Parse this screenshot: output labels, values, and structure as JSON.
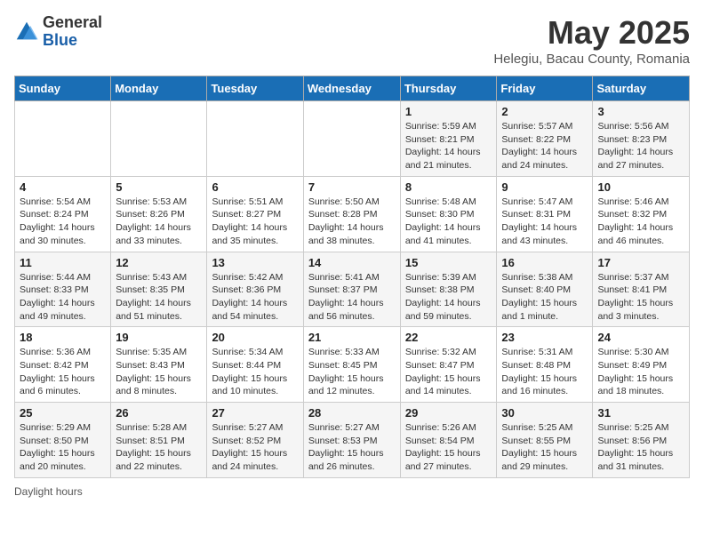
{
  "header": {
    "logo_general": "General",
    "logo_blue": "Blue",
    "title": "May 2025",
    "subtitle": "Helegiu, Bacau County, Romania"
  },
  "days_of_week": [
    "Sunday",
    "Monday",
    "Tuesday",
    "Wednesday",
    "Thursday",
    "Friday",
    "Saturday"
  ],
  "footer": "Daylight hours",
  "weeks": [
    [
      {
        "day": "",
        "info": ""
      },
      {
        "day": "",
        "info": ""
      },
      {
        "day": "",
        "info": ""
      },
      {
        "day": "",
        "info": ""
      },
      {
        "day": "1",
        "info": "Sunrise: 5:59 AM\nSunset: 8:21 PM\nDaylight: 14 hours and 21 minutes."
      },
      {
        "day": "2",
        "info": "Sunrise: 5:57 AM\nSunset: 8:22 PM\nDaylight: 14 hours and 24 minutes."
      },
      {
        "day": "3",
        "info": "Sunrise: 5:56 AM\nSunset: 8:23 PM\nDaylight: 14 hours and 27 minutes."
      }
    ],
    [
      {
        "day": "4",
        "info": "Sunrise: 5:54 AM\nSunset: 8:24 PM\nDaylight: 14 hours and 30 minutes."
      },
      {
        "day": "5",
        "info": "Sunrise: 5:53 AM\nSunset: 8:26 PM\nDaylight: 14 hours and 33 minutes."
      },
      {
        "day": "6",
        "info": "Sunrise: 5:51 AM\nSunset: 8:27 PM\nDaylight: 14 hours and 35 minutes."
      },
      {
        "day": "7",
        "info": "Sunrise: 5:50 AM\nSunset: 8:28 PM\nDaylight: 14 hours and 38 minutes."
      },
      {
        "day": "8",
        "info": "Sunrise: 5:48 AM\nSunset: 8:30 PM\nDaylight: 14 hours and 41 minutes."
      },
      {
        "day": "9",
        "info": "Sunrise: 5:47 AM\nSunset: 8:31 PM\nDaylight: 14 hours and 43 minutes."
      },
      {
        "day": "10",
        "info": "Sunrise: 5:46 AM\nSunset: 8:32 PM\nDaylight: 14 hours and 46 minutes."
      }
    ],
    [
      {
        "day": "11",
        "info": "Sunrise: 5:44 AM\nSunset: 8:33 PM\nDaylight: 14 hours and 49 minutes."
      },
      {
        "day": "12",
        "info": "Sunrise: 5:43 AM\nSunset: 8:35 PM\nDaylight: 14 hours and 51 minutes."
      },
      {
        "day": "13",
        "info": "Sunrise: 5:42 AM\nSunset: 8:36 PM\nDaylight: 14 hours and 54 minutes."
      },
      {
        "day": "14",
        "info": "Sunrise: 5:41 AM\nSunset: 8:37 PM\nDaylight: 14 hours and 56 minutes."
      },
      {
        "day": "15",
        "info": "Sunrise: 5:39 AM\nSunset: 8:38 PM\nDaylight: 14 hours and 59 minutes."
      },
      {
        "day": "16",
        "info": "Sunrise: 5:38 AM\nSunset: 8:40 PM\nDaylight: 15 hours and 1 minute."
      },
      {
        "day": "17",
        "info": "Sunrise: 5:37 AM\nSunset: 8:41 PM\nDaylight: 15 hours and 3 minutes."
      }
    ],
    [
      {
        "day": "18",
        "info": "Sunrise: 5:36 AM\nSunset: 8:42 PM\nDaylight: 15 hours and 6 minutes."
      },
      {
        "day": "19",
        "info": "Sunrise: 5:35 AM\nSunset: 8:43 PM\nDaylight: 15 hours and 8 minutes."
      },
      {
        "day": "20",
        "info": "Sunrise: 5:34 AM\nSunset: 8:44 PM\nDaylight: 15 hours and 10 minutes."
      },
      {
        "day": "21",
        "info": "Sunrise: 5:33 AM\nSunset: 8:45 PM\nDaylight: 15 hours and 12 minutes."
      },
      {
        "day": "22",
        "info": "Sunrise: 5:32 AM\nSunset: 8:47 PM\nDaylight: 15 hours and 14 minutes."
      },
      {
        "day": "23",
        "info": "Sunrise: 5:31 AM\nSunset: 8:48 PM\nDaylight: 15 hours and 16 minutes."
      },
      {
        "day": "24",
        "info": "Sunrise: 5:30 AM\nSunset: 8:49 PM\nDaylight: 15 hours and 18 minutes."
      }
    ],
    [
      {
        "day": "25",
        "info": "Sunrise: 5:29 AM\nSunset: 8:50 PM\nDaylight: 15 hours and 20 minutes."
      },
      {
        "day": "26",
        "info": "Sunrise: 5:28 AM\nSunset: 8:51 PM\nDaylight: 15 hours and 22 minutes."
      },
      {
        "day": "27",
        "info": "Sunrise: 5:27 AM\nSunset: 8:52 PM\nDaylight: 15 hours and 24 minutes."
      },
      {
        "day": "28",
        "info": "Sunrise: 5:27 AM\nSunset: 8:53 PM\nDaylight: 15 hours and 26 minutes."
      },
      {
        "day": "29",
        "info": "Sunrise: 5:26 AM\nSunset: 8:54 PM\nDaylight: 15 hours and 27 minutes."
      },
      {
        "day": "30",
        "info": "Sunrise: 5:25 AM\nSunset: 8:55 PM\nDaylight: 15 hours and 29 minutes."
      },
      {
        "day": "31",
        "info": "Sunrise: 5:25 AM\nSunset: 8:56 PM\nDaylight: 15 hours and 31 minutes."
      }
    ]
  ]
}
